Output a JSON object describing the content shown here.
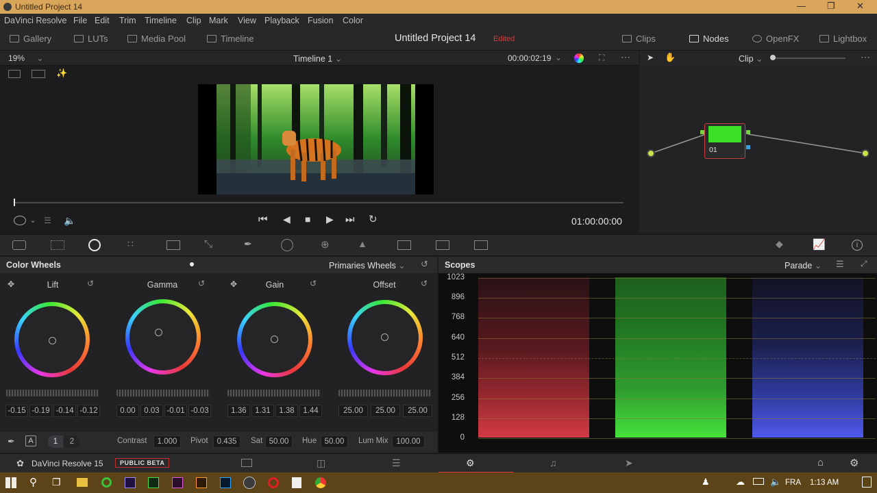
{
  "window": {
    "title": "Untitled Project 14"
  },
  "menu": [
    "DaVinci Resolve",
    "File",
    "Edit",
    "Trim",
    "Timeline",
    "Clip",
    "Mark",
    "View",
    "Playback",
    "Fusion",
    "Color"
  ],
  "pagebar": {
    "left": [
      "Gallery",
      "LUTs",
      "Media Pool",
      "Timeline"
    ],
    "project_title": "Untitled Project 14",
    "edited_label": "Edited",
    "right": [
      "Clips",
      "Nodes",
      "OpenFX",
      "Lightbox"
    ]
  },
  "viewer": {
    "zoom": "19%",
    "timeline_name": "Timeline 1",
    "timecode_top": "00:00:02:19",
    "timecode": "01:00:00:00"
  },
  "nodes": {
    "mode": "Clip",
    "node_label": "01"
  },
  "color_wheels": {
    "title": "Color Wheels",
    "mode": "Primaries Wheels",
    "wheels": [
      {
        "name": "Lift",
        "values": [
          "-0.15",
          "-0.19",
          "-0.14",
          "-0.12"
        ]
      },
      {
        "name": "Gamma",
        "values": [
          "0.00",
          "0.03",
          "-0.01",
          "-0.03"
        ]
      },
      {
        "name": "Gain",
        "values": [
          "1.36",
          "1.31",
          "1.38",
          "1.44"
        ]
      },
      {
        "name": "Offset",
        "values": [
          "25.00",
          "25.00",
          "25.00"
        ]
      }
    ],
    "pages": [
      "1",
      "2"
    ],
    "contrast_label": "Contrast",
    "contrast": "1.000",
    "pivot_label": "Pivot",
    "pivot": "0.435",
    "sat_label": "Sat",
    "sat": "50.00",
    "hue_label": "Hue",
    "hue": "50.00",
    "lummix_label": "Lum Mix",
    "lummix": "100.00"
  },
  "scopes": {
    "title": "Scopes",
    "mode": "Parade",
    "ticks": [
      "1023",
      "896",
      "768",
      "640",
      "512",
      "384",
      "256",
      "128",
      "0"
    ]
  },
  "bottom": {
    "app_name": "DaVinci Resolve 15",
    "badge": "PUBLIC BETA"
  },
  "taskbar": {
    "lang": "FRA",
    "time": "1:13 AM"
  },
  "colors": {
    "accent_red": "#d33c3c",
    "node_green": "#3de028",
    "scope_red": "#c8323c",
    "scope_green": "#38c038",
    "scope_blue": "#4050e0"
  }
}
